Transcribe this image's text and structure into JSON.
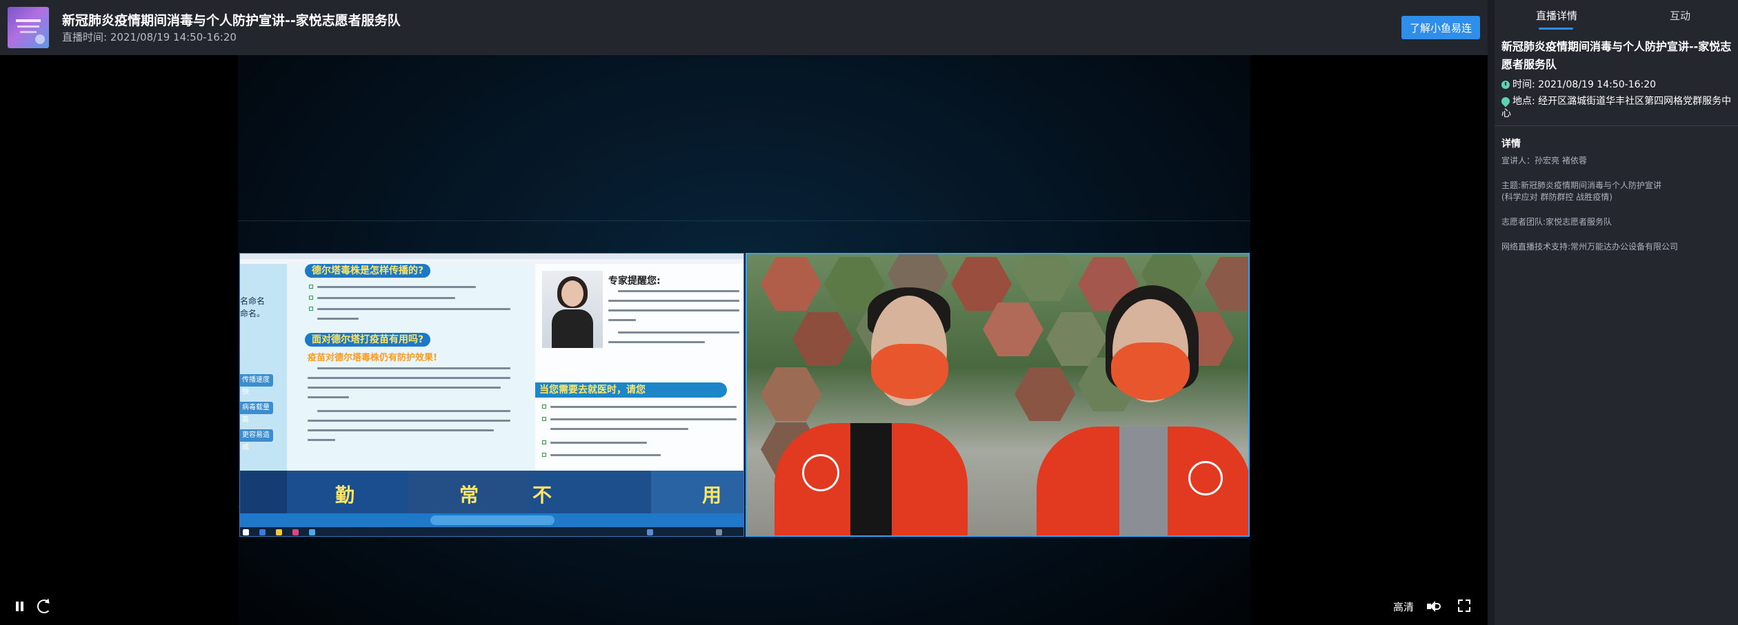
{
  "header": {
    "title": "新冠肺炎疫情期间消毒与个人防护宣讲--家悦志愿者服务队",
    "live_time": "直播时间: 2021/08/19 14:50-16:20",
    "cta_label": "了解小鱼易连"
  },
  "controls": {
    "quality_label": "高清"
  },
  "panel": {
    "tabs": [
      "直播详情",
      "互动"
    ],
    "title": "新冠肺炎疫情期间消毒与个人防护宣讲--家悦志愿者服务队",
    "time": "时间: 2021/08/19 14:50-16:20",
    "location": "地点: 经开区潞城街道华丰社区第四网格党群服务中心",
    "detail_heading": "详情",
    "details": [
      "宣讲人：孙宏亮 褚依蓉",
      "主题:新冠肺炎疫情期间消毒与个人防护宣讲",
      "(科学应对 群防群控 战胜疫情)",
      "志愿者团队:家悦志愿者服务队",
      "网络直播技术支持:常州万能达办公设备有限公司"
    ]
  },
  "slide": {
    "heading1": "德尔塔毒株是怎样传播的?",
    "heading2": "面对德尔塔打疫苗有用吗?",
    "yellow_line": "疫苗对德尔塔毒株仍有防护效果!",
    "expert_title": "专家提醒您:",
    "clinic_heading": "当您需要去就医时，请您",
    "left_labels": [
      "名命名",
      "命名。"
    ],
    "left_chips": [
      "传播速度快",
      "病毒载量高",
      "更容易造成"
    ],
    "banner_chars": [
      "勤",
      "常",
      "不",
      "用"
    ]
  }
}
